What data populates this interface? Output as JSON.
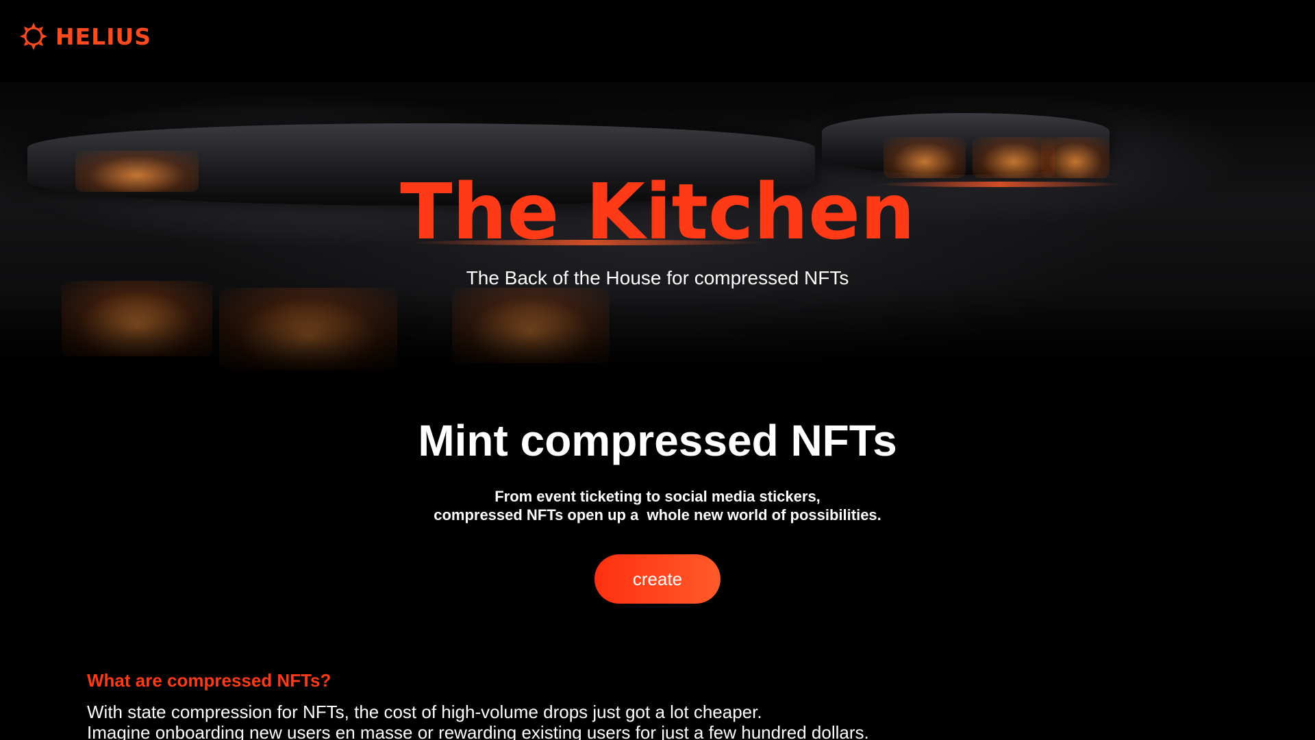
{
  "brand": {
    "name": "HELIUS",
    "logo_icon": "helius-sunburst-icon",
    "accent_color": "#ff3a16"
  },
  "hero": {
    "title": "The Kitchen",
    "subtitle": "The Back of the House for compressed NFTs",
    "background": "dark-kitchen-scene"
  },
  "mint": {
    "heading": "Mint compressed NFTs",
    "description_line1": "From event ticketing to social media stickers,",
    "description_line2": "compressed NFTs open up a  whole new world of possibilities.",
    "create_label": "create"
  },
  "faq": {
    "question": "What are compressed NFTs?",
    "answer_line1": "With state compression for NFTs, the cost of high-volume drops just got a lot cheaper.",
    "answer_line2": "Imagine onboarding new users en masse or rewarding existing users for just a few hundred dollars."
  }
}
